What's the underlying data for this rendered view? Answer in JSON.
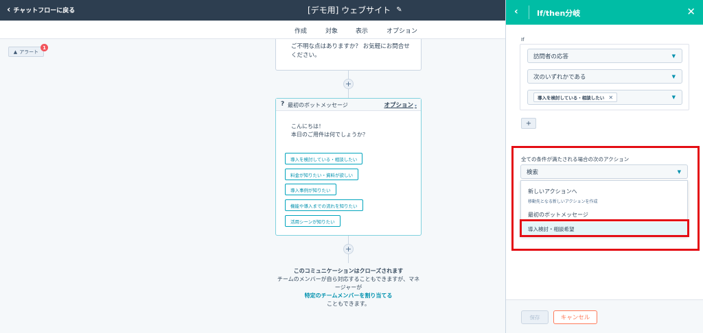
{
  "topbar": {
    "back_label": "チャットフローに戻る",
    "title": "[デモ用] ウェブサイト",
    "edit_icon": "pencil-icon"
  },
  "tabs": [
    {
      "label": "作成",
      "active": true
    },
    {
      "label": "対象",
      "active": false
    },
    {
      "label": "表示",
      "active": false
    },
    {
      "label": "オプション",
      "active": false
    }
  ],
  "canvas": {
    "alert_label": "アラート",
    "alert_count": "1",
    "previous_message": "ご不明な点はありますか？ お気軽にお問合せください。",
    "bot_card": {
      "icon": "?",
      "title": "最初のボットメッセージ",
      "options_label": "オプション",
      "greeting_line1": "こんにちは！",
      "greeting_line2": "本日のご用件は何でしょうか？",
      "quick_replies": [
        "導入を検討している・相談したい",
        "料金が知りたい・資料が欲しい",
        "導入事例が知りたい",
        "機能や導入までの流れを知りたい",
        "活用シーンが知りたい"
      ]
    },
    "closing": {
      "title": "このコミュニケーションはクローズされます",
      "line1": "チームのメンバーが自ら対応することもできますが、マネージャーが",
      "link": "特定のチームメンバーを割り当てる",
      "line2": "こともできます。"
    }
  },
  "panel": {
    "title": "If/then分岐",
    "if_label": "If",
    "condition_property": "訪問者の応答",
    "condition_operator": "次のいずれかである",
    "condition_value_chip": "導入を検討している・相談したい",
    "add_label": "+",
    "action_label": "全ての条件が満たされる場合の次のアクション",
    "action_search_placeholder": "検索",
    "menu": {
      "new_action": "新しいアクションへ",
      "new_action_sub": "移動先となる新しいアクションを作成",
      "first_bot": "最初のボットメッセージ",
      "highlighted": "導入検討・相談希望"
    },
    "save_label": "保存",
    "cancel_label": "キャンセル"
  },
  "colors": {
    "topbar": "#2d3e50",
    "panel_header": "#00bda5",
    "highlight_red": "#e40d14",
    "link": "#0091ae",
    "cancel": "#ff7a59"
  }
}
